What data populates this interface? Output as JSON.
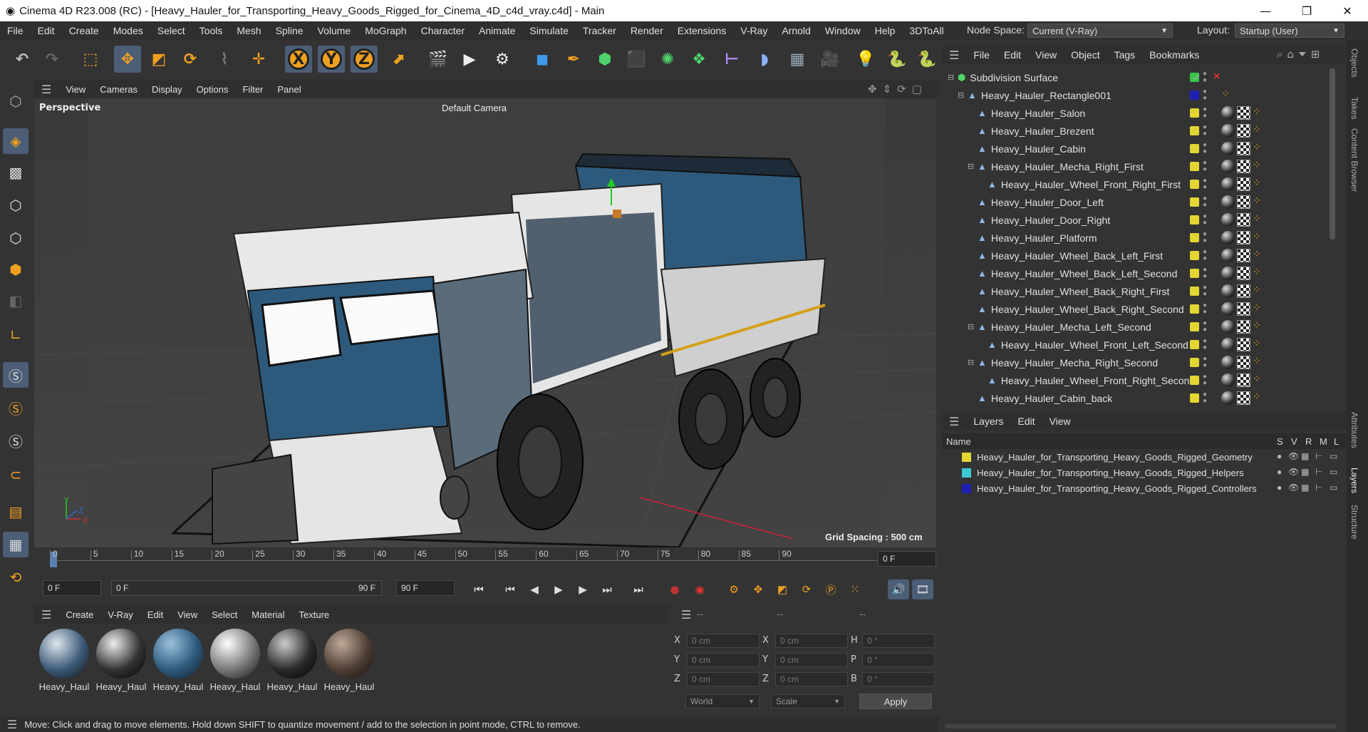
{
  "window": {
    "title": "Cinema 4D R23.008 (RC) - [Heavy_Hauler_for_Transporting_Heavy_Goods_Rigged_for_Cinema_4D_c4d_vray.c4d] - Main"
  },
  "menu": [
    "File",
    "Edit",
    "Create",
    "Modes",
    "Select",
    "Tools",
    "Mesh",
    "Spline",
    "Volume",
    "MoGraph",
    "Character",
    "Animate",
    "Simulate",
    "Tracker",
    "Render",
    "Extensions",
    "V-Ray",
    "Arnold",
    "Window",
    "Help",
    "3DToAll"
  ],
  "node_space": {
    "label": "Node Space:",
    "value": "Current (V-Ray)"
  },
  "layout": {
    "label": "Layout:",
    "value": "Startup (User)"
  },
  "viewport": {
    "menu": [
      "View",
      "Cameras",
      "Display",
      "Options",
      "Filter",
      "Panel"
    ],
    "name": "Perspective",
    "camera": "Default Camera",
    "grid": "Grid Spacing : 500 cm"
  },
  "timeline": {
    "ticks": [
      "0",
      "5",
      "10",
      "15",
      "20",
      "25",
      "30",
      "35",
      "40",
      "45",
      "50",
      "55",
      "60",
      "65",
      "70",
      "75",
      "80",
      "85",
      "90"
    ],
    "current": "0 F"
  },
  "time": {
    "start": "0 F",
    "range_start": "0 F",
    "range_end": "90 F",
    "end": "90 F"
  },
  "materials": {
    "menu": [
      "Create",
      "V-Ray",
      "Edit",
      "View",
      "Select",
      "Material",
      "Texture"
    ],
    "items": [
      "Heavy_Haul",
      "Heavy_Haul",
      "Heavy_Haul",
      "Heavy_Haul",
      "Heavy_Haul",
      "Heavy_Haul"
    ]
  },
  "coords": {
    "head": [
      "--",
      "--",
      "--"
    ],
    "x": "0 cm",
    "y": "0 cm",
    "z": "0 cm",
    "sx": "0 cm",
    "sy": "0 cm",
    "sz": "0 cm",
    "h": "0 °",
    "p": "0 °",
    "b": "0 °",
    "mode": "World",
    "scale": "Scale",
    "apply": "Apply"
  },
  "objects": {
    "menu": [
      "File",
      "Edit",
      "View",
      "Object",
      "Tags",
      "Bookmarks"
    ],
    "rows": [
      "Subdivision Surface",
      "Heavy_Hauler_Rectangle001",
      "Heavy_Hauler_Salon",
      "Heavy_Hauler_Brezent",
      "Heavy_Hauler_Cabin",
      "Heavy_Hauler_Mecha_Right_First",
      "Heavy_Hauler_Wheel_Front_Right_First",
      "Heavy_Hauler_Door_Left",
      "Heavy_Hauler_Door_Right",
      "Heavy_Hauler_Platform",
      "Heavy_Hauler_Wheel_Back_Left_First",
      "Heavy_Hauler_Wheel_Back_Left_Second",
      "Heavy_Hauler_Wheel_Back_Right_First",
      "Heavy_Hauler_Wheel_Back_Right_Second",
      "Heavy_Hauler_Mecha_Left_Second",
      "Heavy_Hauler_Wheel_Front_Left_Second",
      "Heavy_Hauler_Mecha_Right_Second",
      "Heavy_Hauler_Wheel_Front_Right_Second",
      "Heavy_Hauler_Cabin_back"
    ]
  },
  "layers": {
    "menu": [
      "Layers",
      "Edit",
      "View"
    ],
    "head": {
      "name": "Name",
      "cols": [
        "S",
        "V",
        "R",
        "M",
        "L"
      ]
    },
    "rows": [
      {
        "name": "Heavy_Hauler_for_Transporting_Heavy_Goods_Rigged_Geometry",
        "color": "#e3d532"
      },
      {
        "name": "Heavy_Hauler_for_Transporting_Heavy_Goods_Rigged_Helpers",
        "color": "#3cc9d4"
      },
      {
        "name": "Heavy_Hauler_for_Transporting_Heavy_Goods_Rigged_Controllers",
        "color": "#1f1fb4"
      }
    ]
  },
  "side_tabs": [
    "Objects",
    "Takes",
    "Content Browser",
    "Attributes",
    "Layers",
    "Structure"
  ],
  "status": "Move: Click and drag to move elements. Hold down SHIFT to quantize movement / add to the selection in point mode, CTRL to remove.",
  "icons": {
    "undo": "undo-icon",
    "move": "move-icon",
    "scale": "scale-icon",
    "rotate": "rotate-icon"
  }
}
